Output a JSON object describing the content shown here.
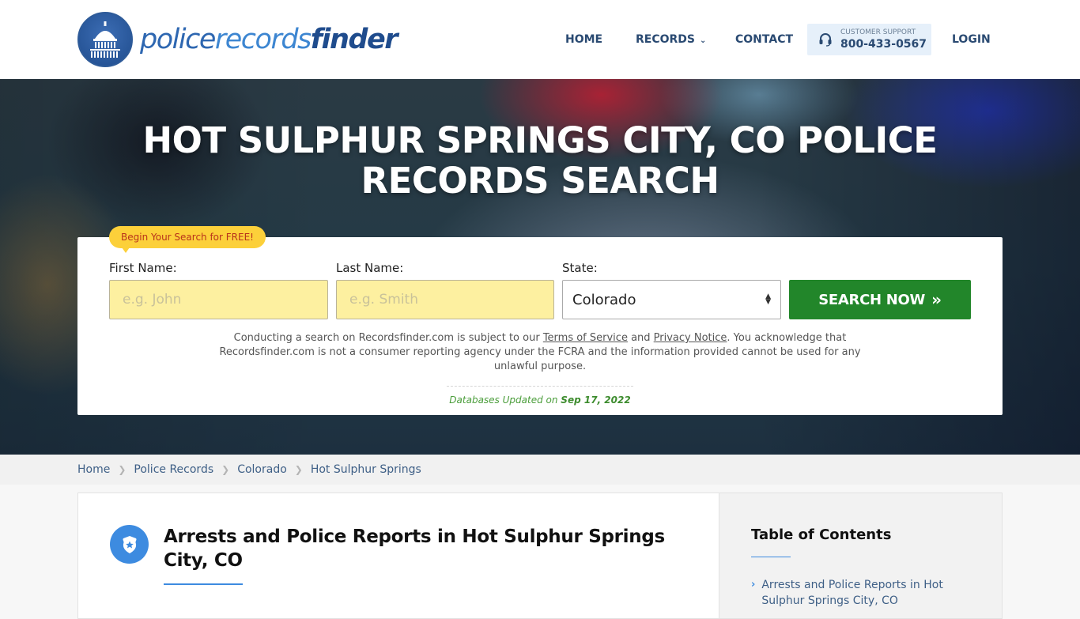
{
  "header": {
    "logo": {
      "part1": "police",
      "part2": "records",
      "part3": "finder",
      "icon": "capitol-building-icon"
    },
    "nav": {
      "home": "HOME",
      "records": "RECORDS",
      "contact": "CONTACT",
      "login": "LOGIN"
    },
    "support": {
      "label": "CUSTOMER SUPPORT",
      "phone": "800-433-0567",
      "icon": "headset-icon"
    }
  },
  "hero": {
    "title": "HOT SULPHUR SPRINGS CITY, CO POLICE RECORDS SEARCH"
  },
  "search": {
    "badge": "Begin Your Search for FREE!",
    "first_name_label": "First Name:",
    "first_name_placeholder": "e.g. John",
    "first_name_value": "",
    "last_name_label": "Last Name:",
    "last_name_placeholder": "e.g. Smith",
    "last_name_value": "",
    "state_label": "State:",
    "state_value": "Colorado",
    "button_label": "SEARCH NOW",
    "button_icon": "double-chevron-right-icon",
    "disclaimer": {
      "part1": "Conducting a search on Recordsfinder.com is subject to our ",
      "terms_link": "Terms of Service",
      "part2": " and ",
      "privacy_link": "Privacy Notice",
      "part3": ". You acknowledge that Recordsfinder.com is not a consumer reporting agency under the FCRA and the information provided cannot be used for any unlawful purpose."
    },
    "db_updated_label": "Databases Updated on",
    "db_updated_date": "Sep 17, 2022"
  },
  "breadcrumb": [
    {
      "label": "Home"
    },
    {
      "label": "Police Records"
    },
    {
      "label": "Colorado"
    },
    {
      "label": "Hot Sulphur Springs"
    }
  ],
  "article": {
    "icon": "police-badge-icon",
    "title": "Arrests and Police Reports in Hot Sulphur Springs City, CO"
  },
  "toc": {
    "title": "Table of Contents",
    "items": [
      {
        "label": "Arrests and Police Reports in Hot Sulphur Springs City, CO"
      }
    ]
  },
  "colors": {
    "brand_dark": "#1f4c8d",
    "brand_light": "#3d86d1",
    "search_green": "#22862a",
    "badge_yellow": "#fcd03a",
    "input_yellow": "#fdf0a0",
    "accent_blue": "#3d8be0"
  }
}
